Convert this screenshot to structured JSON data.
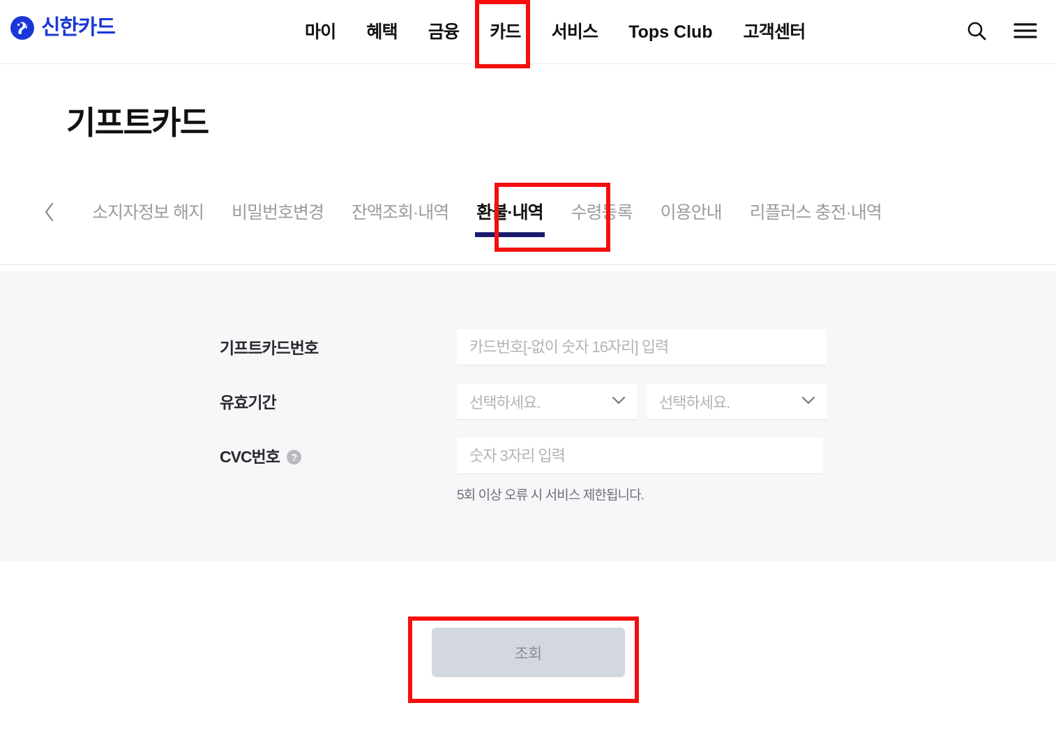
{
  "header": {
    "brand": {
      "name": "신한카드",
      "logo_icon": "shinhan-circle-logo-icon",
      "color": "#1a37d8"
    },
    "nav": [
      {
        "label": "마이",
        "id": "my"
      },
      {
        "label": "혜택",
        "id": "benefits"
      },
      {
        "label": "금융",
        "id": "finance"
      },
      {
        "label": "카드",
        "id": "card"
      },
      {
        "label": "서비스",
        "id": "service"
      },
      {
        "label": "Tops Club",
        "id": "tops-club"
      },
      {
        "label": "고객센터",
        "id": "customer-center"
      }
    ],
    "active_nav": "카드",
    "icons": {
      "search": "search-icon",
      "menu": "hamburger-menu-icon"
    }
  },
  "page": {
    "title": "기프트카드"
  },
  "tabs": {
    "prev_icon": "chevron-left-icon",
    "items": [
      {
        "label": "소지자정보 해지",
        "active": false
      },
      {
        "label": "비밀번호변경",
        "active": false
      },
      {
        "label": "잔액조회·내역",
        "active": false
      },
      {
        "label": "환불·내역",
        "active": true
      },
      {
        "label": "수령등록",
        "active": false
      },
      {
        "label": "이용안내",
        "active": false
      },
      {
        "label": "리플러스 충전·내역",
        "active": false
      }
    ],
    "active_underline_color": "#1a1a6e"
  },
  "form": {
    "card_number": {
      "label": "기프트카드번호",
      "placeholder": "카드번호[-없이 숫자 16자리] 입력",
      "value": ""
    },
    "expiry": {
      "label": "유효기간",
      "month": {
        "value": "선택하세요.",
        "chevron": "chevron-down-icon"
      },
      "year": {
        "value": "선택하세요.",
        "chevron": "chevron-down-icon"
      }
    },
    "cvc": {
      "label": "CVC번호",
      "help_icon": "question-mark-help-icon",
      "placeholder": "숫자 3자리 입력",
      "value": "",
      "note": "5회 이상 오류 시 서비스 제한됩니다."
    }
  },
  "submit": {
    "label": "조회",
    "disabled": true
  },
  "annotations": {
    "color": "#f50f0f",
    "boxes": [
      "nav-card",
      "tab-refund-history",
      "submit-button"
    ]
  }
}
